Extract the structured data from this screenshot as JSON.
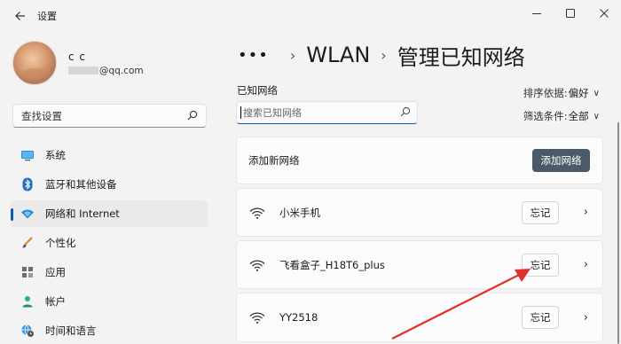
{
  "window": {
    "title": "设置",
    "back_icon": "back-arrow-icon",
    "controls": [
      "minimize-icon",
      "maximize-icon",
      "close-icon"
    ]
  },
  "profile": {
    "name": "c c",
    "email": "@qq.com"
  },
  "sidebar": {
    "search_placeholder": "查找设置",
    "items": [
      {
        "label": "系统",
        "icon": "display-icon",
        "active": false
      },
      {
        "label": "蓝牙和其他设备",
        "icon": "bluetooth-icon",
        "active": false
      },
      {
        "label": "网络和 Internet",
        "icon": "wifi-diamond-icon",
        "active": true
      },
      {
        "label": "个性化",
        "icon": "brush-icon",
        "active": false
      },
      {
        "label": "应用",
        "icon": "apps-icon",
        "active": false
      },
      {
        "label": "帐户",
        "icon": "person-icon",
        "active": false
      },
      {
        "label": "时间和语言",
        "icon": "globe-clock-icon",
        "active": false
      }
    ]
  },
  "breadcrumb": {
    "dots": "•••",
    "parent": "WLAN",
    "current": "管理已知网络"
  },
  "known": {
    "label": "已知网络",
    "search_placeholder": "搜索已知网络",
    "sort_label": "排序依据:",
    "sort_value": "偏好",
    "filter_label": "筛选条件:",
    "filter_value": "全部"
  },
  "add_network": {
    "label": "添加新网络",
    "button": "添加网络"
  },
  "networks": [
    {
      "name": "小米手机",
      "forget": "忘记"
    },
    {
      "name": "飞看盒子_H18T6_plus",
      "forget": "忘记"
    },
    {
      "name": "YY2518",
      "forget": "忘记"
    }
  ],
  "colors": {
    "accent": "#0a5fb4",
    "add_button": "#4b5a66",
    "annotation_arrow": "#e0302a"
  }
}
